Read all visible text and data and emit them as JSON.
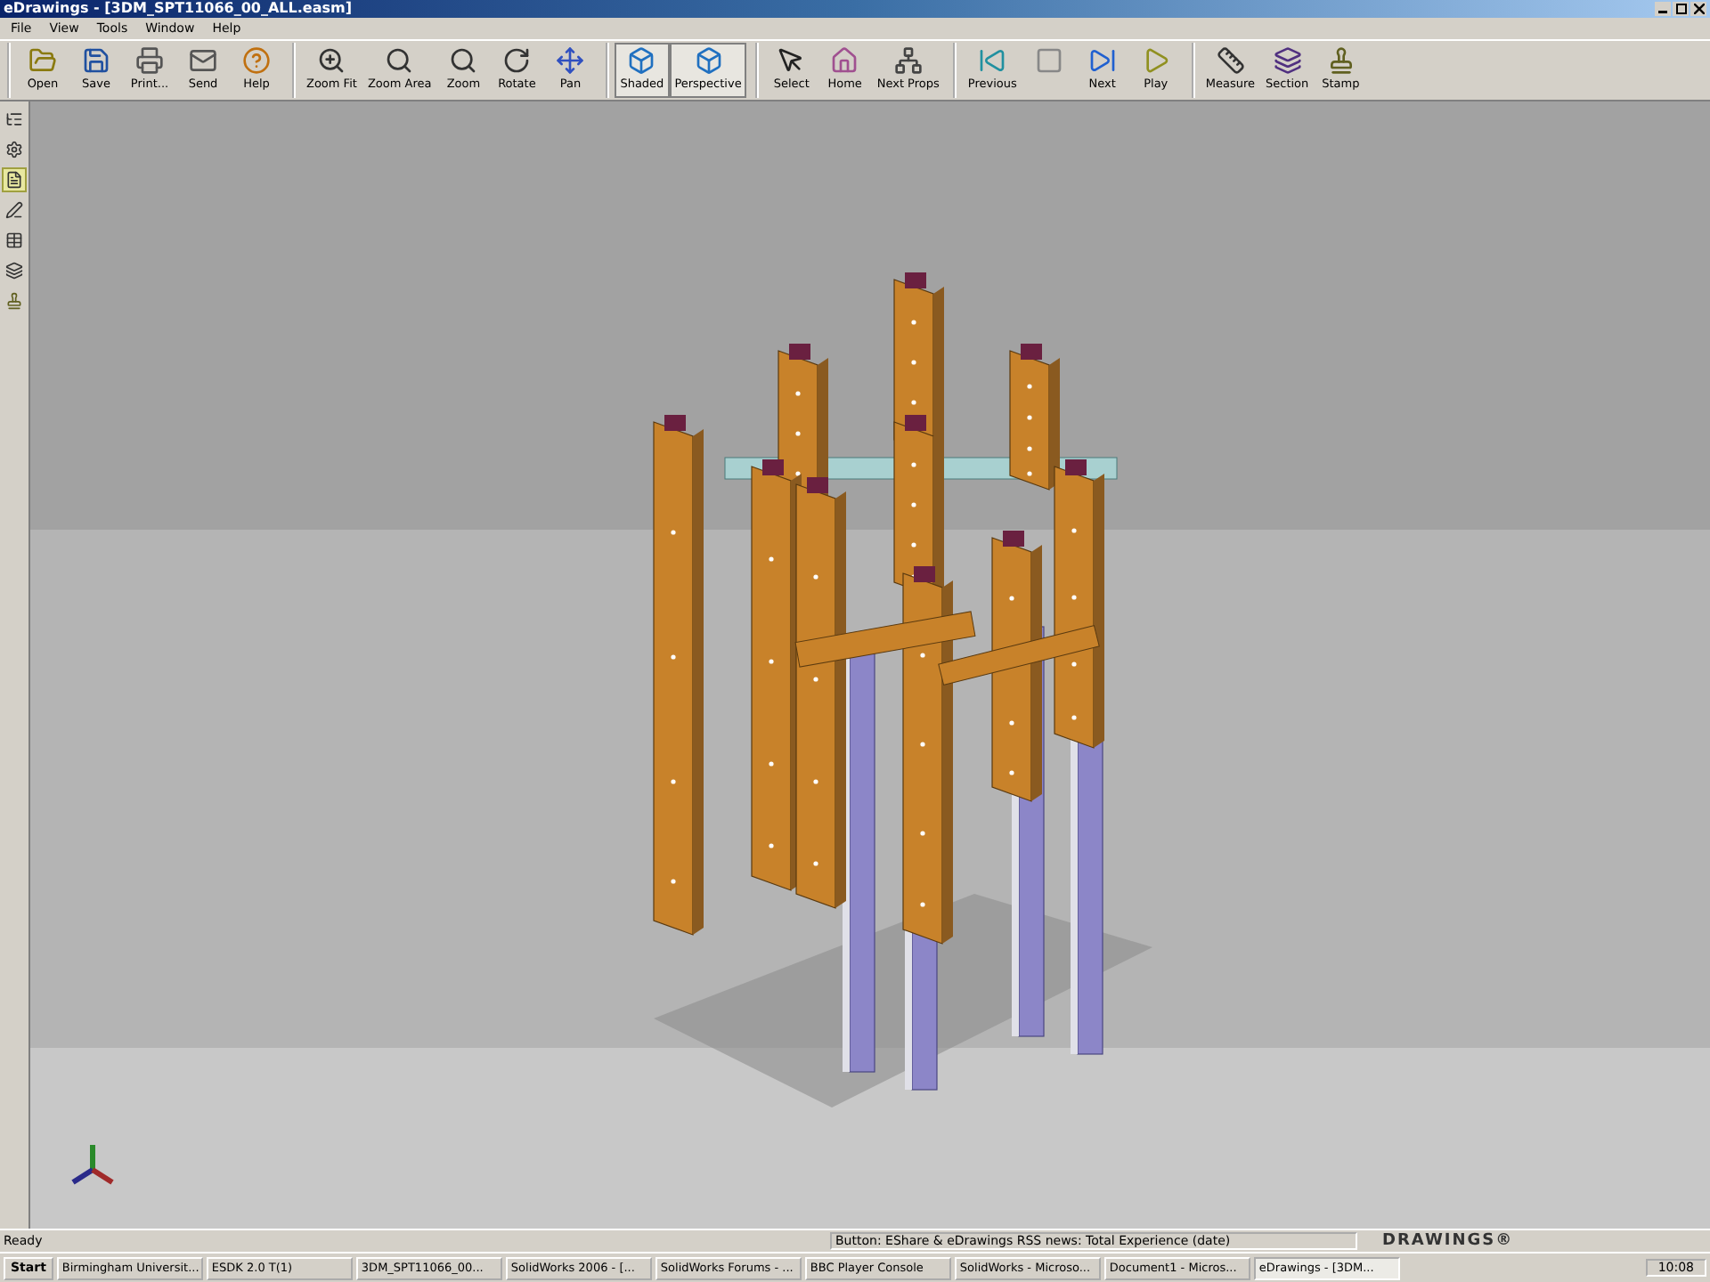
{
  "window": {
    "title": "eDrawings - [3DM_SPT11066_00_ALL.easm]"
  },
  "menu": [
    "File",
    "View",
    "Tools",
    "Window",
    "Help"
  ],
  "toolbar": [
    [
      {
        "label": "Open",
        "selected": false
      },
      {
        "label": "Save",
        "selected": false
      },
      {
        "label": "Print...",
        "selected": false
      },
      {
        "label": "Send",
        "selected": false
      },
      {
        "label": "Help",
        "selected": false
      }
    ],
    [
      {
        "label": "Zoom Fit",
        "selected": false
      },
      {
        "label": "Zoom Area",
        "selected": false
      },
      {
        "label": "Zoom",
        "selected": false
      },
      {
        "label": "Rotate",
        "selected": false
      },
      {
        "label": "Pan",
        "selected": false
      }
    ],
    [
      {
        "label": "Shaded",
        "selected": true
      },
      {
        "label": "Perspective",
        "selected": true
      }
    ],
    [
      {
        "label": "Select",
        "selected": false
      },
      {
        "label": "Home",
        "selected": false
      },
      {
        "label": "Next Props",
        "selected": false
      }
    ],
    [
      {
        "label": "Previous",
        "selected": false
      },
      {
        "selected": false
      },
      {
        "label": "Next",
        "selected": false
      },
      {
        "label": "Play",
        "selected": false
      }
    ],
    [
      {
        "label": "Measure",
        "selected": false
      },
      {
        "label": "Section",
        "selected": false
      },
      {
        "label": "Stamp",
        "selected": false
      }
    ]
  ],
  "side_tools": [
    {
      "selected": false
    },
    {
      "selected": false
    },
    {
      "selected": true
    },
    {
      "selected": false
    },
    {
      "selected": false
    },
    {
      "selected": false
    },
    {
      "selected": false
    }
  ],
  "status_bar": {
    "text": "Ready",
    "message": "Button: EShare & eDrawings RSS news: Total Experience (date)",
    "logo": "DRAWINGS®"
  },
  "taskbar": {
    "start": "Start",
    "tasks": [
      {
        "label": "Birmingham Universit...",
        "selected": false
      },
      {
        "label": "ESDK 2.0 T(1)",
        "selected": false
      },
      {
        "label": "3DM_SPT11066_00...",
        "selected": false
      },
      {
        "label": "SolidWorks 2006 - [...",
        "selected": false
      },
      {
        "label": "SolidWorks Forums - ...",
        "selected": false
      },
      {
        "label": "BBC Player Console",
        "selected": false
      },
      {
        "label": "SolidWorks - Microso...",
        "selected": false
      },
      {
        "label": "Document1 - Micros...",
        "selected": false
      },
      {
        "label": "eDrawings - [3DM...",
        "selected": true
      }
    ],
    "clock": "10:08"
  }
}
